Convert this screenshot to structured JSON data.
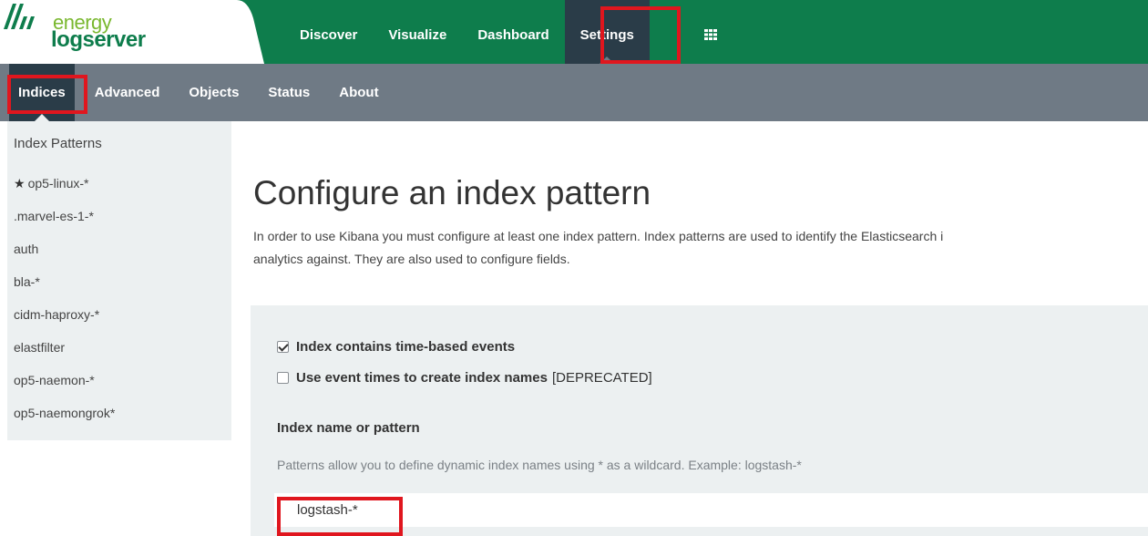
{
  "logo": {
    "line1": "energy",
    "line2": "logserver"
  },
  "top_nav": {
    "items": [
      {
        "label": "Discover"
      },
      {
        "label": "Visualize"
      },
      {
        "label": "Dashboard"
      },
      {
        "label": "Settings",
        "active": true
      }
    ],
    "apps_icon": "grid-icon"
  },
  "sub_nav": {
    "items": [
      {
        "label": "Indices",
        "active": true
      },
      {
        "label": "Advanced"
      },
      {
        "label": "Objects"
      },
      {
        "label": "Status"
      },
      {
        "label": "About"
      }
    ]
  },
  "sidebar": {
    "title": "Index Patterns",
    "items": [
      {
        "label": "op5-linux-*",
        "default": true,
        "icon": "star-icon"
      },
      {
        "label": ".marvel-es-1-*"
      },
      {
        "label": "auth"
      },
      {
        "label": "bla-*"
      },
      {
        "label": "cidm-haproxy-*"
      },
      {
        "label": "elastfilter"
      },
      {
        "label": "op5-naemon-*"
      },
      {
        "label": "op5-naemongrok*"
      }
    ]
  },
  "main": {
    "title": "Configure an index pattern",
    "intro_line1": "In order to use Kibana you must configure at least one index pattern. Index patterns are used to identify the Elasticsearch i",
    "intro_line2": "analytics against. They are also used to configure fields.",
    "time_based_label": "Index contains time-based events",
    "time_based_checked": true,
    "event_times_label": "Use event times to create index names",
    "event_times_tag": "[DEPRECATED]",
    "event_times_checked": false,
    "field_label": "Index name or pattern",
    "help_text": "Patterns allow you to define dynamic index names using * as a wildcard. Example: logstash-*",
    "pattern_value": "logstash-*"
  },
  "colors": {
    "top_bar": "#0e7d4c",
    "sub_bar": "#6f7a85",
    "active_tab": "#2a3c48",
    "highlight": "#e0161e",
    "panel": "#ecf0f1"
  }
}
